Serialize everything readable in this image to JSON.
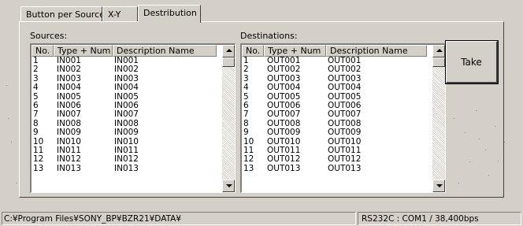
{
  "tabs": [
    {
      "label": "Button per Source"
    },
    {
      "label": "X-Y"
    },
    {
      "label": "Destribution"
    }
  ],
  "sources": {
    "label": "Sources:",
    "columns": [
      "No.",
      "Type + Num",
      "Description Name"
    ],
    "rows": [
      [
        "1",
        "IN001",
        "IN001"
      ],
      [
        "2",
        "IN002",
        "IN002"
      ],
      [
        "3",
        "IN003",
        "IN003"
      ],
      [
        "4",
        "IN004",
        "IN004"
      ],
      [
        "5",
        "IN005",
        "IN005"
      ],
      [
        "6",
        "IN006",
        "IN006"
      ],
      [
        "7",
        "IN007",
        "IN007"
      ],
      [
        "8",
        "IN008",
        "IN008"
      ],
      [
        "9",
        "IN009",
        "IN009"
      ],
      [
        "10",
        "IN010",
        "IN010"
      ],
      [
        "11",
        "IN011",
        "IN011"
      ],
      [
        "12",
        "IN012",
        "IN012"
      ],
      [
        "13",
        "IN013",
        "IN013"
      ]
    ]
  },
  "destinations": {
    "label": "Destinations:",
    "columns": [
      "No.",
      "Type + Num",
      "Description Name"
    ],
    "rows": [
      [
        "1",
        "OUT001",
        "OUT001"
      ],
      [
        "2",
        "OUT002",
        "OUT002"
      ],
      [
        "3",
        "OUT003",
        "OUT003"
      ],
      [
        "4",
        "OUT004",
        "OUT004"
      ],
      [
        "5",
        "OUT005",
        "OUT005"
      ],
      [
        "6",
        "OUT006",
        "OUT006"
      ],
      [
        "7",
        "OUT007",
        "OUT007"
      ],
      [
        "8",
        "OUT008",
        "OUT008"
      ],
      [
        "9",
        "OUT009",
        "OUT009"
      ],
      [
        "10",
        "OUT010",
        "OUT010"
      ],
      [
        "11",
        "OUT011",
        "OUT011"
      ],
      [
        "12",
        "OUT012",
        "OUT012"
      ],
      [
        "13",
        "OUT013",
        "OUT013"
      ]
    ]
  },
  "take_button": {
    "label": "Take"
  },
  "statusbar": {
    "path": "C:¥Program Files¥SONY_BP¥BZR21¥DATA¥",
    "connection": "RS232C : COM1 / 38,400bps"
  }
}
